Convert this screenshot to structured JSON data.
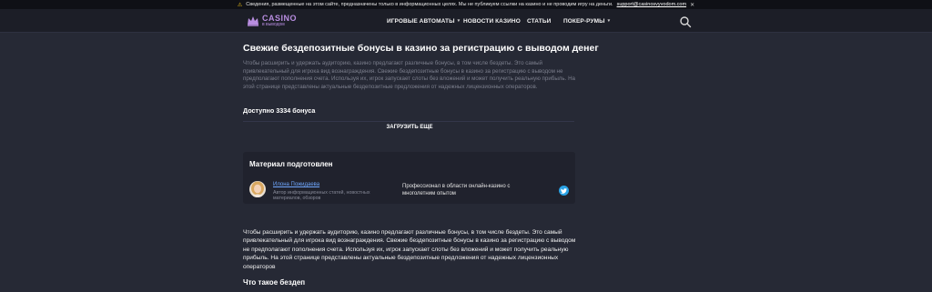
{
  "notice": {
    "text": "Сведения, размещенные на этом сайте, предназначены только в информационных целях. Мы не публикуем ссылки на казино и не проводим игру на деньги.",
    "email": "support@casinosvyvodom.com",
    "close_label": "✕"
  },
  "header": {
    "logo_main": "CASINO",
    "logo_sub": "в выводом",
    "nav": [
      {
        "label": "ИГРОВЫЕ АВТОМАТЫ",
        "chevron": "▾"
      },
      {
        "label": "НОВОСТИ КАЗИНО",
        "chevron": ""
      },
      {
        "label": "СТАТЬИ",
        "chevron": ""
      },
      {
        "label": "ПОКЕР-РУМЫ",
        "chevron": "▾"
      }
    ],
    "search_icon": "search-icon"
  },
  "main": {
    "title": "Свежие бездепозитные бонусы в казино за регистрацию с выводом денег",
    "intro": "Чтобы расширить и удержать аудиторию, казино предлагают различные бонусы, в том числе бездеты. Это самый привлекательный для игрока вид вознаграждения. Свежие бездепозитные бонусы в казино за регистрацию с выводом не предполагают пополнения счета. Используя их, игрок запускает слоты без вложений и может получить реальную прибыль. На этой странице представлены актуальные бездепозитные предложения от надежных лицензионных операторов.",
    "count": "Доступно 3334 бонуса",
    "load_more": "ЗАГРУЗИТЬ ЕЩЕ"
  },
  "author_card": {
    "title": "Материал подготовлен",
    "name": "Илона Пожидаева",
    "description": "Автор информационных статей, новостных материалов, обзоров",
    "profession": "Профессионал в области онлайн-казино с многолетним опытом",
    "social_icon": "twitter-icon"
  },
  "article": {
    "paragraph": "Чтобы расширить и удержать аудиторию, казино предлагают различные бонусы, в том числе бездеты. Это самый привлекательный для игрока вид вознаграждения. Свежие бездепозитные бонусы в казино за регистрацию с выводом не предполагают пополнения счета. Используя их, игрок запускает слоты без вложений и может получить реальную прибыль. На этой странице представлены актуальные бездепозитные предложения от надежных лицензионных операторов",
    "heading": "Что такое бездеп"
  },
  "colors": {
    "page_bg": "#262935",
    "header_bg": "#1c1e27",
    "brand_purple": "#b88de0",
    "link_blue": "#6fa8ff",
    "twitter_blue": "#2aa3e6"
  }
}
